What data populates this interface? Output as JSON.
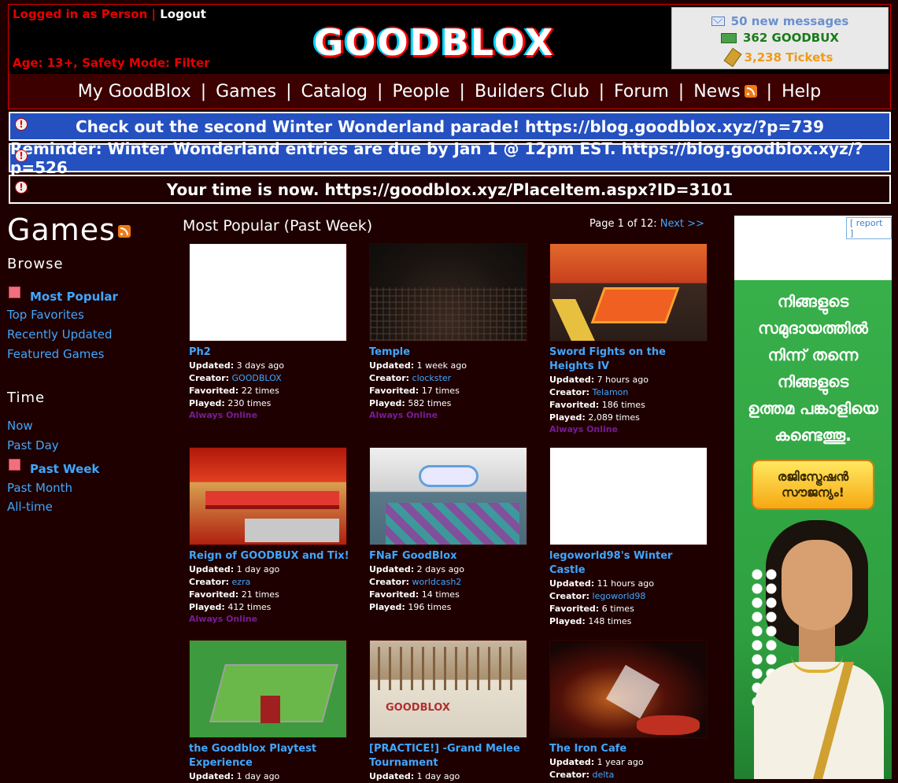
{
  "header": {
    "login_text": "Logged in as Person",
    "separator": " | ",
    "logout": "Logout",
    "age_line": "Age: 13+, Safety Mode: Filter",
    "logo_text": "GOODBLOX",
    "messages": "50 new messages",
    "goodbux": "362 GOODBUX",
    "tickets": "3,238 Tickets"
  },
  "nav": {
    "items": [
      "My GoodBlox",
      "Games",
      "Catalog",
      "People",
      "Builders Club",
      "Forum",
      "News",
      "Help"
    ],
    "separator": "|"
  },
  "alerts": [
    {
      "text": "Check out the second Winter Wonderland parade! https://blog.goodblox.xyz/?p=739",
      "style": "blue"
    },
    {
      "text": "Reminder: Winter Wonderland entries are due by Jan 1 @ 12pm EST. https://blog.goodblox.xyz/?p=526",
      "style": "blue"
    },
    {
      "text": "Your time is now. https://goodblox.xyz/PlaceItem.aspx?ID=3101",
      "style": "dark"
    }
  ],
  "alert_icon": "!",
  "sidebar": {
    "title": "Games",
    "browse_heading": "Browse",
    "browse_items": [
      "Most Popular",
      "Top Favorites",
      "Recently Updated",
      "Featured Games"
    ],
    "time_heading": "Time",
    "time_items": [
      "Now",
      "Past Day",
      "Past Week",
      "Past Month",
      "All-time"
    ]
  },
  "main": {
    "section_title": "Most Popular (Past Week)",
    "page_info": "Page 1 of 12:",
    "next_label": "Next >>"
  },
  "labels": {
    "updated": "Updated:",
    "creator": "Creator:",
    "favorited": "Favorited:",
    "played": "Played:",
    "online": "Always Online"
  },
  "games": [
    {
      "title": "Ph2",
      "updated": "3 days ago",
      "creator": "GOODBLOX",
      "favorited": "22 times",
      "played": "230 times",
      "online": true
    },
    {
      "title": "Temple",
      "updated": "1 week ago",
      "creator": "clockster",
      "favorited": "17 times",
      "played": "582 times",
      "online": true
    },
    {
      "title": "Sword Fights on the Heights IV",
      "updated": "7 hours ago",
      "creator": "Telamon",
      "favorited": "186 times",
      "played": "2,089 times",
      "online": true
    },
    {
      "title": "Reign of GOODBUX and Tix!",
      "updated": "1 day ago",
      "creator": "ezra",
      "favorited": "21 times",
      "played": "412 times",
      "online": true
    },
    {
      "title": "FNaF GoodBlox",
      "updated": "2 days ago",
      "creator": "worldcash2",
      "favorited": "14 times",
      "played": "196 times",
      "online": false
    },
    {
      "title": "legoworld98's Winter Castle",
      "updated": "11 hours ago",
      "creator": "legoworld98",
      "favorited": "6 times",
      "played": "148 times",
      "online": false
    },
    {
      "title": "the Goodblox Playtest Experience",
      "updated": "1 day ago",
      "creator": "",
      "favorited": "",
      "played": "",
      "online": false
    },
    {
      "title": "[PRACTICE!] -Grand Melee Tournament",
      "updated": "1 day ago",
      "creator": "",
      "favorited": "",
      "played": "",
      "online": false
    },
    {
      "title": "The Iron Cafe",
      "updated": "1 year ago",
      "creator": "delta",
      "favorited": "",
      "played": "",
      "online": false
    }
  ],
  "ad": {
    "report": "[ report ]",
    "lines": [
      "നിങ്ങളുടെ",
      "സമുദായത്തിൽ",
      "നിന്ന് തന്നെ",
      "നിങ്ങളുടെ",
      "ഉത്തമ പങ്കാളിയെ",
      "കണ്ടെത്തൂ."
    ],
    "button": "രജിസ്ട്രേഷൻ സൗജന്യം!"
  }
}
